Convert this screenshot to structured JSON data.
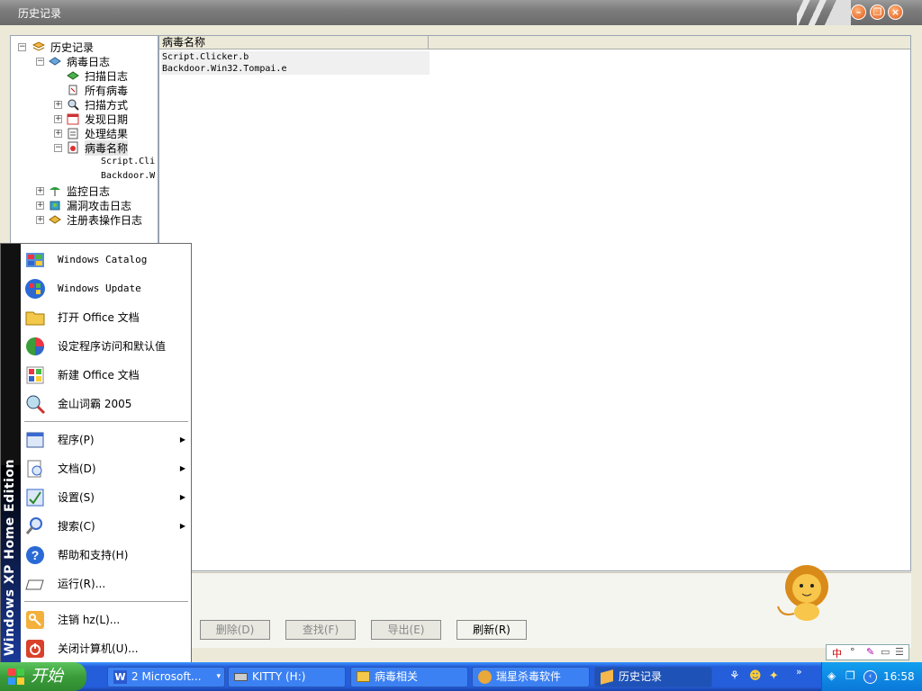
{
  "window": {
    "title": "历史记录"
  },
  "tree": {
    "root": "历史记录",
    "virus_log": "病毒日志",
    "children": [
      "扫描日志",
      "所有病毒",
      "扫描方式",
      "发现日期",
      "处理结果",
      "病毒名称"
    ],
    "leafs": [
      "Script.Cli",
      "Backdoor.W"
    ],
    "others": [
      "监控日志",
      "漏洞攻击日志",
      "注册表操作日志"
    ]
  },
  "list": {
    "header": "病毒名称",
    "rows": [
      "Script.Clicker.b",
      "Backdoor.Win32.Tompai.e"
    ]
  },
  "buttons": {
    "delete": "删除(D)",
    "find": "查找(F)",
    "export": "导出(E)",
    "refresh": "刷新(R)"
  },
  "startmenu": {
    "sidebar": "Windows XP  Home Edition",
    "top": [
      "Windows Catalog",
      "Windows Update",
      "打开 Office 文档",
      "设定程序访问和默认值",
      "新建 Office 文档",
      "金山词霸 2005"
    ],
    "main": [
      "程序(P)",
      "文档(D)",
      "设置(S)",
      "搜索(C)",
      "帮助和支持(H)",
      "运行(R)..."
    ],
    "bottom": [
      "注销 hz(L)...",
      "关闭计算机(U)..."
    ]
  },
  "taskbar": {
    "start": "开始",
    "items": [
      "2 Microsoft...",
      "KITTY (H:)",
      "病毒相关",
      "瑞星杀毒软件",
      "历史记录"
    ],
    "clock": "16:58"
  }
}
